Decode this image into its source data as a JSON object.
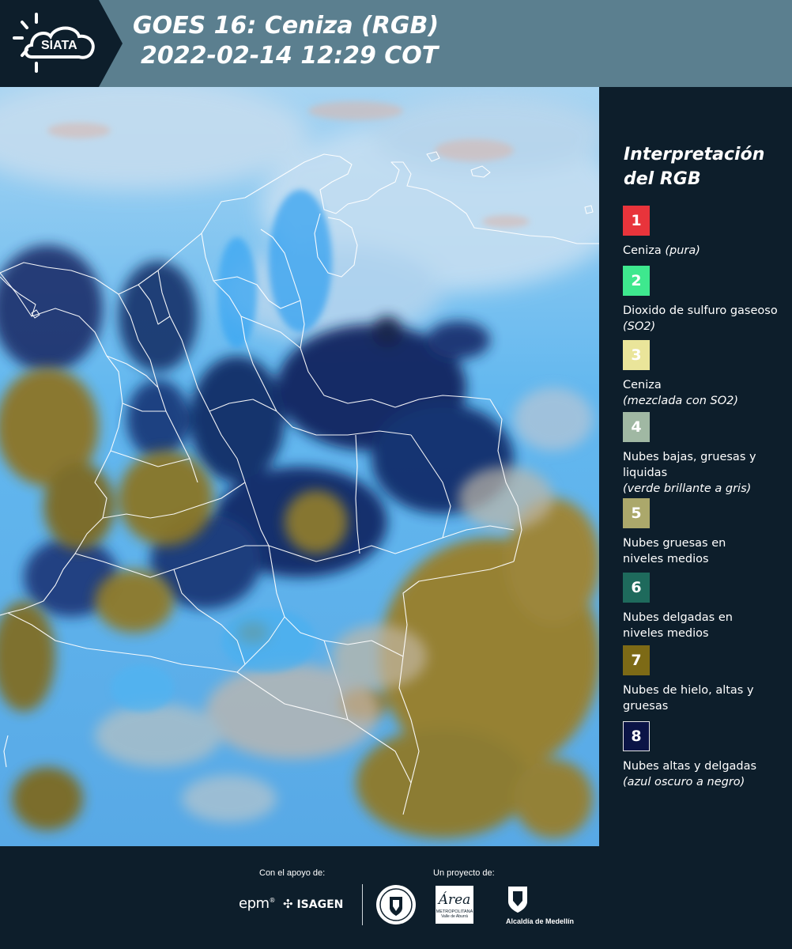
{
  "header": {
    "logo_text": "SIATA",
    "title_line1": "GOES 16: Ceniza (RGB)",
    "title_line2": "2022-02-14 12:29 COT"
  },
  "legend": {
    "title": "Interpretación del RGB",
    "items": [
      {
        "number": "1",
        "text": "Ceniza",
        "note": "(pura)",
        "color": "#e8343b"
      },
      {
        "number": "2",
        "text": "Dioxido de sulfuro gaseoso",
        "note": "(SO2)",
        "color": "#3ee88e"
      },
      {
        "number": "3",
        "text": "Ceniza",
        "note": "(mezclada con SO2)",
        "color": "#eae59a"
      },
      {
        "number": "4",
        "text": "Nubes bajas, gruesas y liquidas",
        "note": "(verde brillante a gris)",
        "color": "#a0b8a3"
      },
      {
        "number": "5",
        "text": "Nubes gruesas en niveles medios",
        "note": "",
        "color": "#aba86b"
      },
      {
        "number": "6",
        "text": "Nubes delgadas en niveles medios",
        "note": "",
        "color": "#1e6a5c"
      },
      {
        "number": "7",
        "text": "Nubes de hielo, altas y gruesas",
        "note": "",
        "color": "#7d6a16"
      },
      {
        "number": "8",
        "text": "Nubes altas y delgadas",
        "note": "(azul oscuro a negro)",
        "color": "#0b1446"
      }
    ]
  },
  "footer": {
    "support_label": "Con el apoyo de:",
    "project_label": "Un proyecto de:",
    "sponsor_epm": "epm",
    "sponsor_isagen": "ISAGEN",
    "partner_area_name": "Área",
    "partner_area_sub1": "METROPOLITANA",
    "partner_area_sub2": "Valle de Aburrá",
    "partner_alcaldia": "Alcaldía de Medellín"
  }
}
